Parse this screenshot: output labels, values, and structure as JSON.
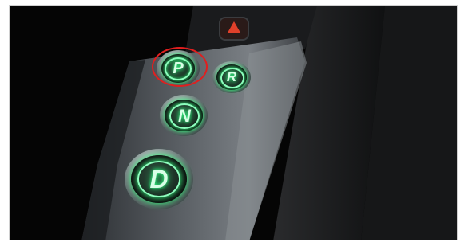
{
  "hazard": {
    "label": "hazard-warning-button"
  },
  "gear_buttons": [
    {
      "key": "park",
      "letter": "P",
      "highlighted": true
    },
    {
      "key": "reverse",
      "letter": "R",
      "highlighted": false
    },
    {
      "key": "neutral",
      "letter": "N",
      "highlighted": false
    },
    {
      "key": "drive",
      "letter": "D",
      "highlighted": false
    }
  ],
  "colors": {
    "glow": "#2cff7a",
    "highlight_ring": "#e01f1f",
    "hazard_red": "#c8281a",
    "console": "#6f7378",
    "background": "#050505"
  }
}
